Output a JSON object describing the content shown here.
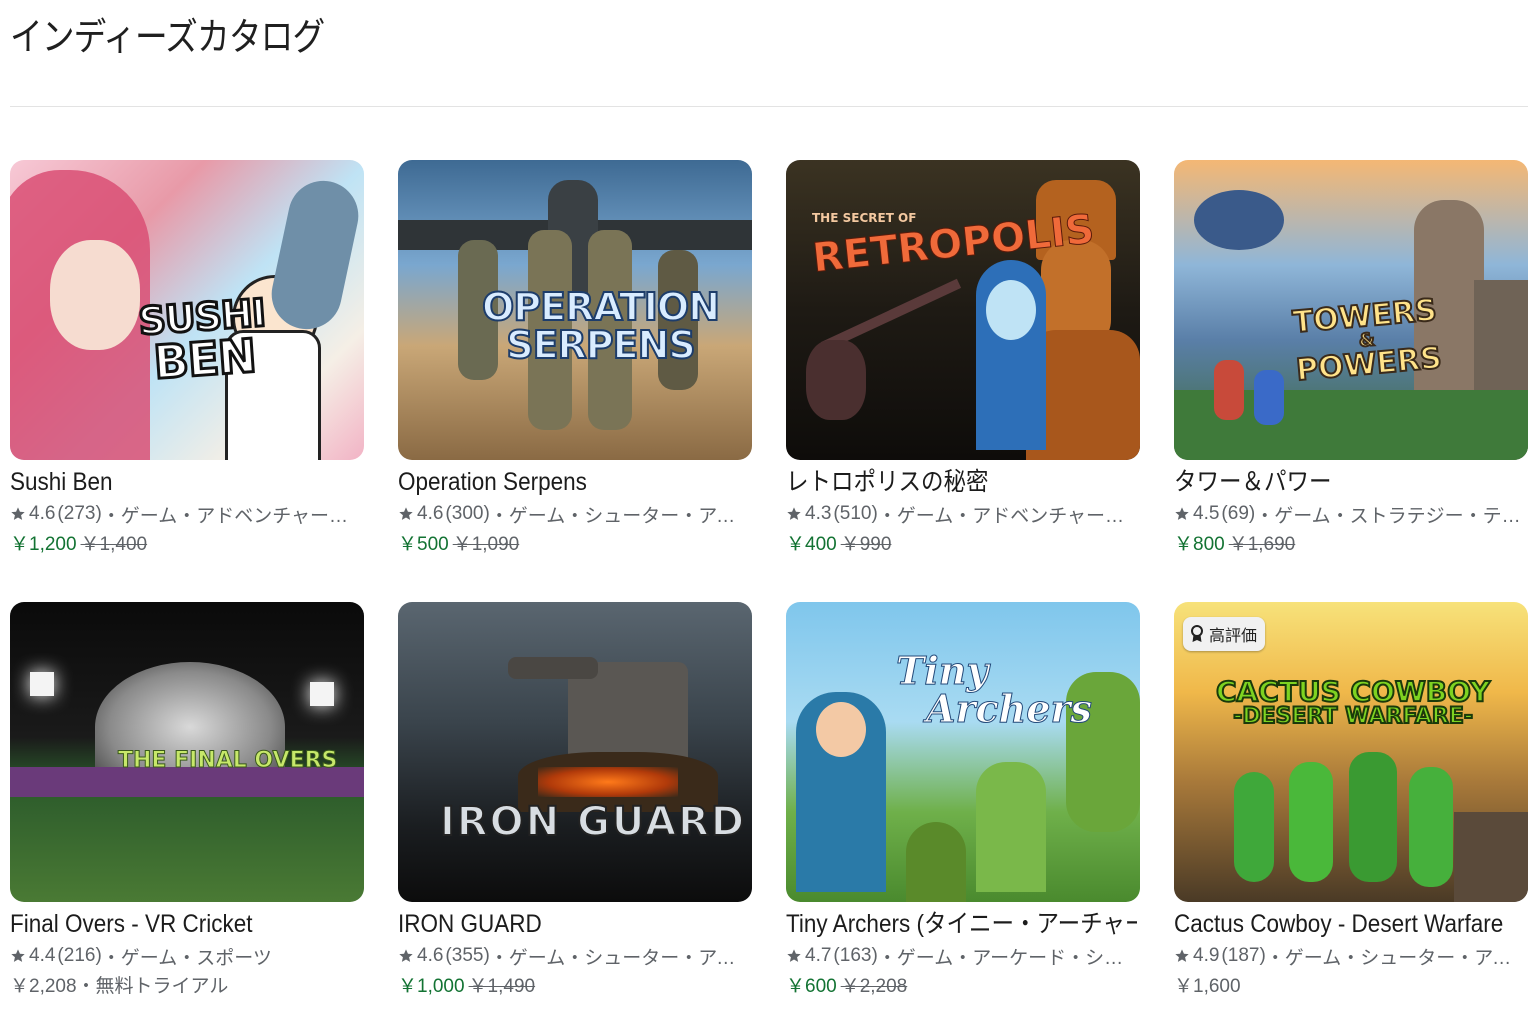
{
  "header": {
    "title": "インディーズカタログ"
  },
  "cards": [
    {
      "title": "Sushi Ben",
      "rating": "4.6",
      "count": "(273)",
      "categories": "・ゲーム・アドベンチャー・物語",
      "price": "￥1,200",
      "original_price": "￥1,400",
      "art_text": [
        "SUSHI",
        "BEN"
      ]
    },
    {
      "title": "Operation Serpens",
      "rating": "4.6",
      "count": "(300)",
      "categories": "・ゲーム・シューター・アーケード・アクション",
      "price": "￥500",
      "original_price": "￥1,090",
      "art_text": [
        "OPERATION",
        "SERPENS"
      ]
    },
    {
      "title": "レトロポリスの秘密",
      "rating": "4.3",
      "count": "(510)",
      "categories": "・ゲーム・アドベンチャー・パズル・物語",
      "price": "￥400",
      "original_price": "￥990",
      "art_text": [
        "THE SECRET OF",
        "RETROPOLIS"
      ]
    },
    {
      "title": "タワー＆パワー",
      "rating": "4.5",
      "count": "(69)",
      "categories": "・ゲーム・ストラテジー・テーブルゲーム",
      "price": "￥800",
      "original_price": "￥1,690",
      "art_text": [
        "TOWERS",
        "&",
        "POWERS"
      ]
    },
    {
      "title": "Final Overs - VR Cricket",
      "rating": "4.4",
      "count": "(216)",
      "categories": "・ゲーム・スポーツ",
      "price": "￥2,208",
      "price_note": "・無料トライアル",
      "art_text": [
        "THE FINAL OVERS"
      ]
    },
    {
      "title": "IRON GUARD",
      "rating": "4.6",
      "count": "(355)",
      "categories": "・ゲーム・シューター・アクション・ストラテジー",
      "price": "￥1,000",
      "original_price": "￥1,490",
      "art_text": [
        "IRON GUARD"
      ]
    },
    {
      "title": "Tiny Archers (タイニー・アーチャーズ)",
      "rating": "4.7",
      "count": "(163)",
      "categories": "・ゲーム・アーケード・シューター・アクション",
      "price": "￥600",
      "original_price": "￥2,208",
      "art_text": [
        "Tiny",
        "Archers"
      ]
    },
    {
      "title": "Cactus Cowboy - Desert Warfare",
      "rating": "4.9",
      "count": "(187)",
      "categories": "・ゲーム・シューター・アーケード・アクション",
      "price": "￥1,600",
      "badge": "高評価",
      "art_text": [
        "CACTUS COWBOY",
        "-DESERT WARFARE-"
      ]
    }
  ],
  "colors": {
    "accent_price": "#137333",
    "meta_gray": "#5f6368",
    "star": "#5f6368"
  },
  "icons": {
    "rating": "star-icon",
    "badge": "award-icon"
  }
}
